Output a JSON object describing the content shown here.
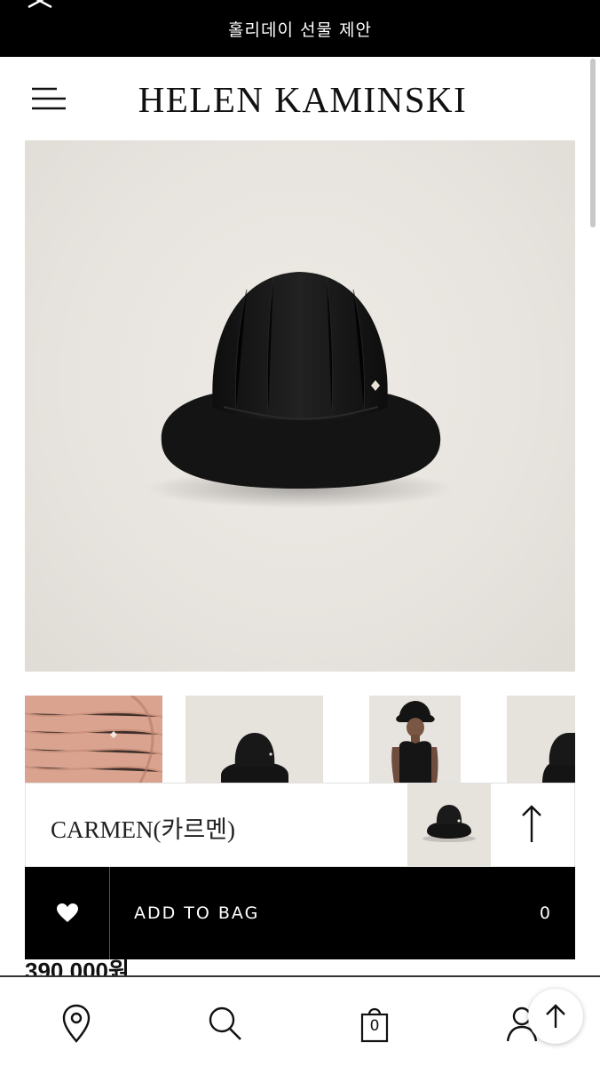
{
  "promo": {
    "text": "홀리데이 선물 제안"
  },
  "header": {
    "brand": "HELEN KAMINSKI"
  },
  "product": {
    "name": "CARMEN(카르멘)",
    "price": "390,000원"
  },
  "bag_bar": {
    "add_label": "ADD TO BAG",
    "count": "0"
  },
  "nav": {
    "cart_count": "0"
  },
  "icons": {
    "close": "close-icon",
    "menu": "menu-icon",
    "wishlist": "heart-icon",
    "scroll_top": "arrow-up-icon",
    "location": "map-pin-icon",
    "search": "search-icon",
    "cart": "shopping-bag-icon",
    "account": "user-icon"
  },
  "colors": {
    "bar": "#000000",
    "hat": "#161616",
    "backdrop": "#e9e6e1",
    "straw": "#d9a38f"
  }
}
